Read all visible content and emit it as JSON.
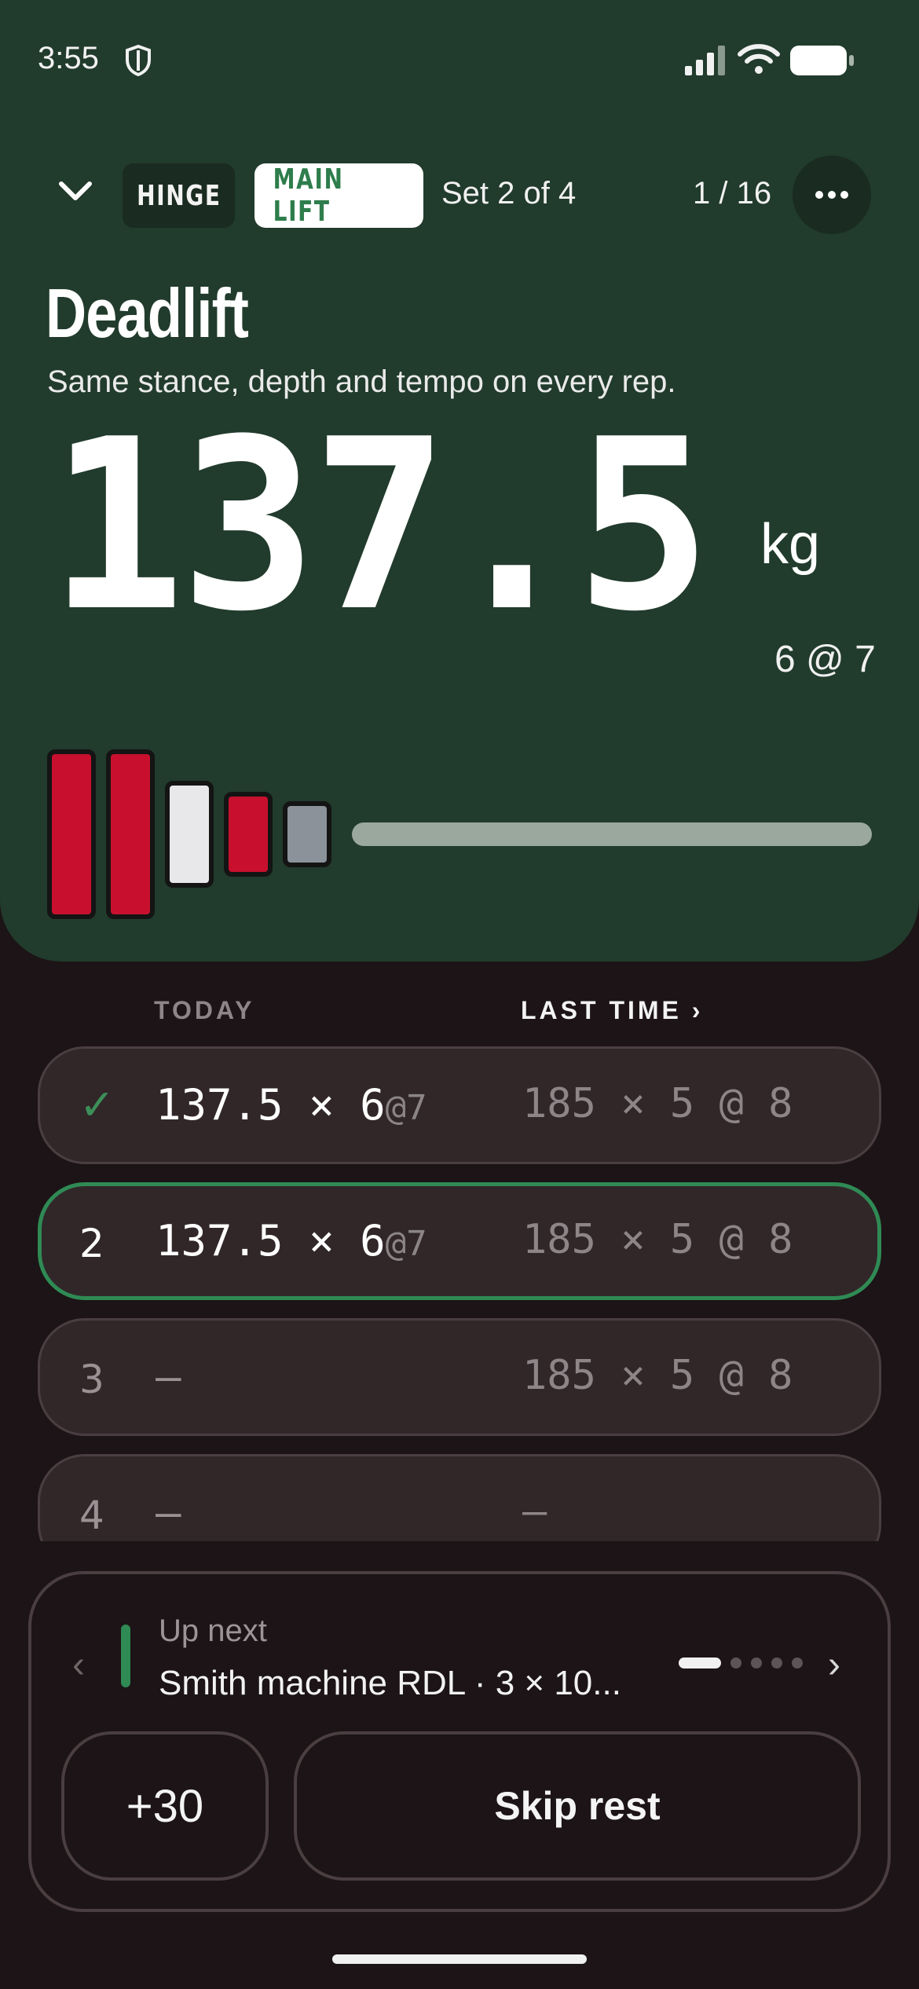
{
  "status_bar": {
    "time": "3:55",
    "icons": [
      "shield-icon",
      "signal-icon",
      "wifi-icon",
      "battery-icon"
    ]
  },
  "header": {
    "collapse_icon": "chevron-down-icon",
    "category_tag": "HINGE",
    "role_tag": "MAIN LIFT",
    "set_label": "Set 2 of 4",
    "exercise_counter": "1 / 16",
    "more_icon": "more-horizontal-icon"
  },
  "exercise": {
    "name": "Deadlift",
    "cue": "Same stance, depth and tempo on every rep.",
    "weight": "137.5",
    "unit": "kg",
    "target": "6 @ 7"
  },
  "plates": [
    {
      "color": "#c8102e",
      "label": "red-plate"
    },
    {
      "color": "#c8102e",
      "label": "red-plate"
    },
    {
      "color": "#e8e8ea",
      "label": "white-plate"
    },
    {
      "color": "#c8102e",
      "label": "red-plate"
    },
    {
      "color": "#8c9299",
      "label": "grey-plate"
    }
  ],
  "colors": {
    "hero_bg": "#213b2c",
    "page_bg": "#1c1416",
    "accent_green": "#2f8a54",
    "row_bg": "#312729"
  },
  "table": {
    "col_today": "TODAY",
    "col_last": "LAST TIME ›",
    "rows": [
      {
        "index": "✓",
        "done": true,
        "today_main": "137.5 × 6",
        "today_rpe": "@7",
        "last": "185 × 5 @ 8"
      },
      {
        "index": "2",
        "active": true,
        "today_main": "137.5 × 6",
        "today_rpe": "@7",
        "last": "185 × 5 @ 8"
      },
      {
        "index": "3",
        "today_dash": "–",
        "last": "185 × 5 @ 8"
      },
      {
        "index": "4",
        "today_dash": "–",
        "last": "–"
      }
    ]
  },
  "up_next": {
    "label": "Up next",
    "name": "Smith machine RDL · 3 × 10...",
    "prev_icon": "‹",
    "next_icon": "›",
    "page_dots": 5,
    "active_dot": 0
  },
  "actions": {
    "add_time": "+30",
    "skip_rest": "Skip rest"
  }
}
